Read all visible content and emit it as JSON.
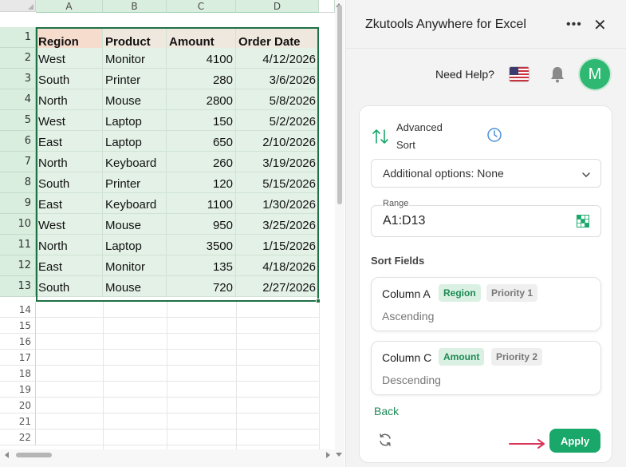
{
  "sheet": {
    "columns": [
      "A",
      "B",
      "C",
      "D"
    ],
    "rows": [
      "1",
      "2",
      "3",
      "4",
      "5",
      "6",
      "7",
      "8",
      "9",
      "10",
      "11",
      "12",
      "13",
      "14",
      "15",
      "16",
      "17",
      "18",
      "19",
      "20",
      "21",
      "22"
    ],
    "headers": [
      "Region",
      "Product",
      "Amount",
      "Order Date"
    ],
    "data": [
      [
        "West",
        "Monitor",
        "4100",
        "4/12/2026"
      ],
      [
        "South",
        "Printer",
        "280",
        "3/6/2026"
      ],
      [
        "North",
        "Mouse",
        "2800",
        "5/8/2026"
      ],
      [
        "West",
        "Laptop",
        "150",
        "5/2/2026"
      ],
      [
        "East",
        "Laptop",
        "650",
        "2/10/2026"
      ],
      [
        "North",
        "Keyboard",
        "260",
        "3/19/2026"
      ],
      [
        "South",
        "Printer",
        "120",
        "5/15/2026"
      ],
      [
        "East",
        "Keyboard",
        "1100",
        "1/30/2026"
      ],
      [
        "West",
        "Mouse",
        "950",
        "3/25/2026"
      ],
      [
        "North",
        "Laptop",
        "3500",
        "1/15/2026"
      ],
      [
        "East",
        "Monitor",
        "135",
        "4/18/2026"
      ],
      [
        "South",
        "Mouse",
        "720",
        "2/27/2026"
      ]
    ],
    "colors": {
      "selection_border": "#1e7145",
      "selected_fill": "#e3f1e6",
      "header_fill": "#f6dccd"
    }
  },
  "panel": {
    "title": "Zkutools Anywhere for Excel",
    "more_icon": "more-horizontal-icon",
    "close_icon": "close-icon",
    "help_text": "Need Help?",
    "avatar_letter": "M",
    "feature_title_line1": "Advanced",
    "feature_title_line2": "Sort",
    "options_dropdown": "Additional options: None",
    "range_label": "Range",
    "range_value": "A1:D13",
    "sort_fields_title": "Sort Fields",
    "sort_fields": [
      {
        "column": "Column A",
        "field": "Region",
        "priority": "Priority 1",
        "order": "Ascending"
      },
      {
        "column": "Column C",
        "field": "Amount",
        "priority": "Priority 2",
        "order": "Descending"
      }
    ],
    "back_label": "Back",
    "apply_label": "Apply",
    "colors": {
      "accent": "#1aa76a",
      "avatar": "#2eb872",
      "pointer_arrow": "#d9365a"
    }
  }
}
